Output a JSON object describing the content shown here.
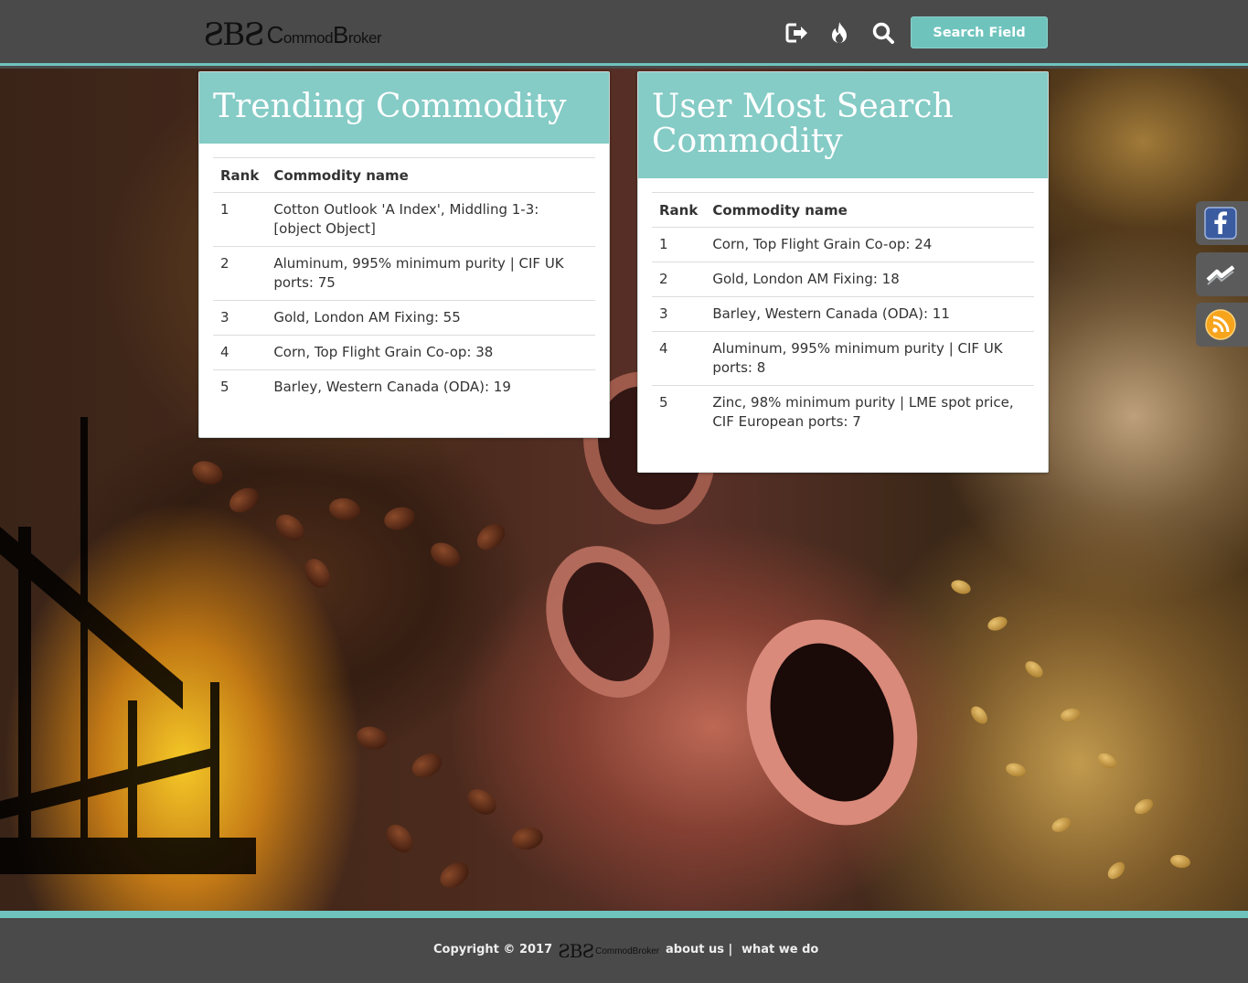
{
  "header": {
    "logo_mark": "ƧBƧ",
    "logo_word": {
      "c": "C",
      "ommod": "ommod",
      "b": "B",
      "roker": "roker"
    },
    "icons": [
      "sign-out-icon",
      "fire-icon",
      "search-icon"
    ],
    "search_button_label": "Search Field",
    "accent_color": "#6fc3bd"
  },
  "trending": {
    "title": "Trending Commodity",
    "columns": [
      "Rank",
      "Commodity name"
    ],
    "rows": [
      {
        "rank": "1",
        "name": "Cotton Outlook 'A Index', Middling 1-3: [object Object]"
      },
      {
        "rank": "2",
        "name": "Aluminum, 995% minimum purity | CIF UK ports: 75"
      },
      {
        "rank": "3",
        "name": "Gold, London AM Fixing: 55"
      },
      {
        "rank": "4",
        "name": "Corn, Top Flight Grain Co-op: 38"
      },
      {
        "rank": "5",
        "name": "Barley, Western Canada (ODA): 19"
      }
    ]
  },
  "most_searched": {
    "title": "User Most Search Commodity",
    "columns": [
      "Rank",
      "Commodity name"
    ],
    "rows": [
      {
        "rank": "1",
        "name": "Corn, Top Flight Grain Co-op: 24"
      },
      {
        "rank": "2",
        "name": "Gold, London AM Fixing: 18"
      },
      {
        "rank": "3",
        "name": "Barley, Western Canada (ODA): 11"
      },
      {
        "rank": "4",
        "name": "Aluminum, 995% minimum purity | CIF UK ports: 8"
      },
      {
        "rank": "5",
        "name": "Zinc, 98% minimum purity | LME spot price, CIF European ports: 7"
      }
    ]
  },
  "social": [
    "facebook-icon",
    "stocktwits-icon",
    "rss-icon"
  ],
  "footer": {
    "copyright": "Copyright © 2017",
    "logo_mark": "ƧBƧ",
    "logo_word": "CommodBroker",
    "links": [
      "about us |",
      "what we do"
    ]
  }
}
